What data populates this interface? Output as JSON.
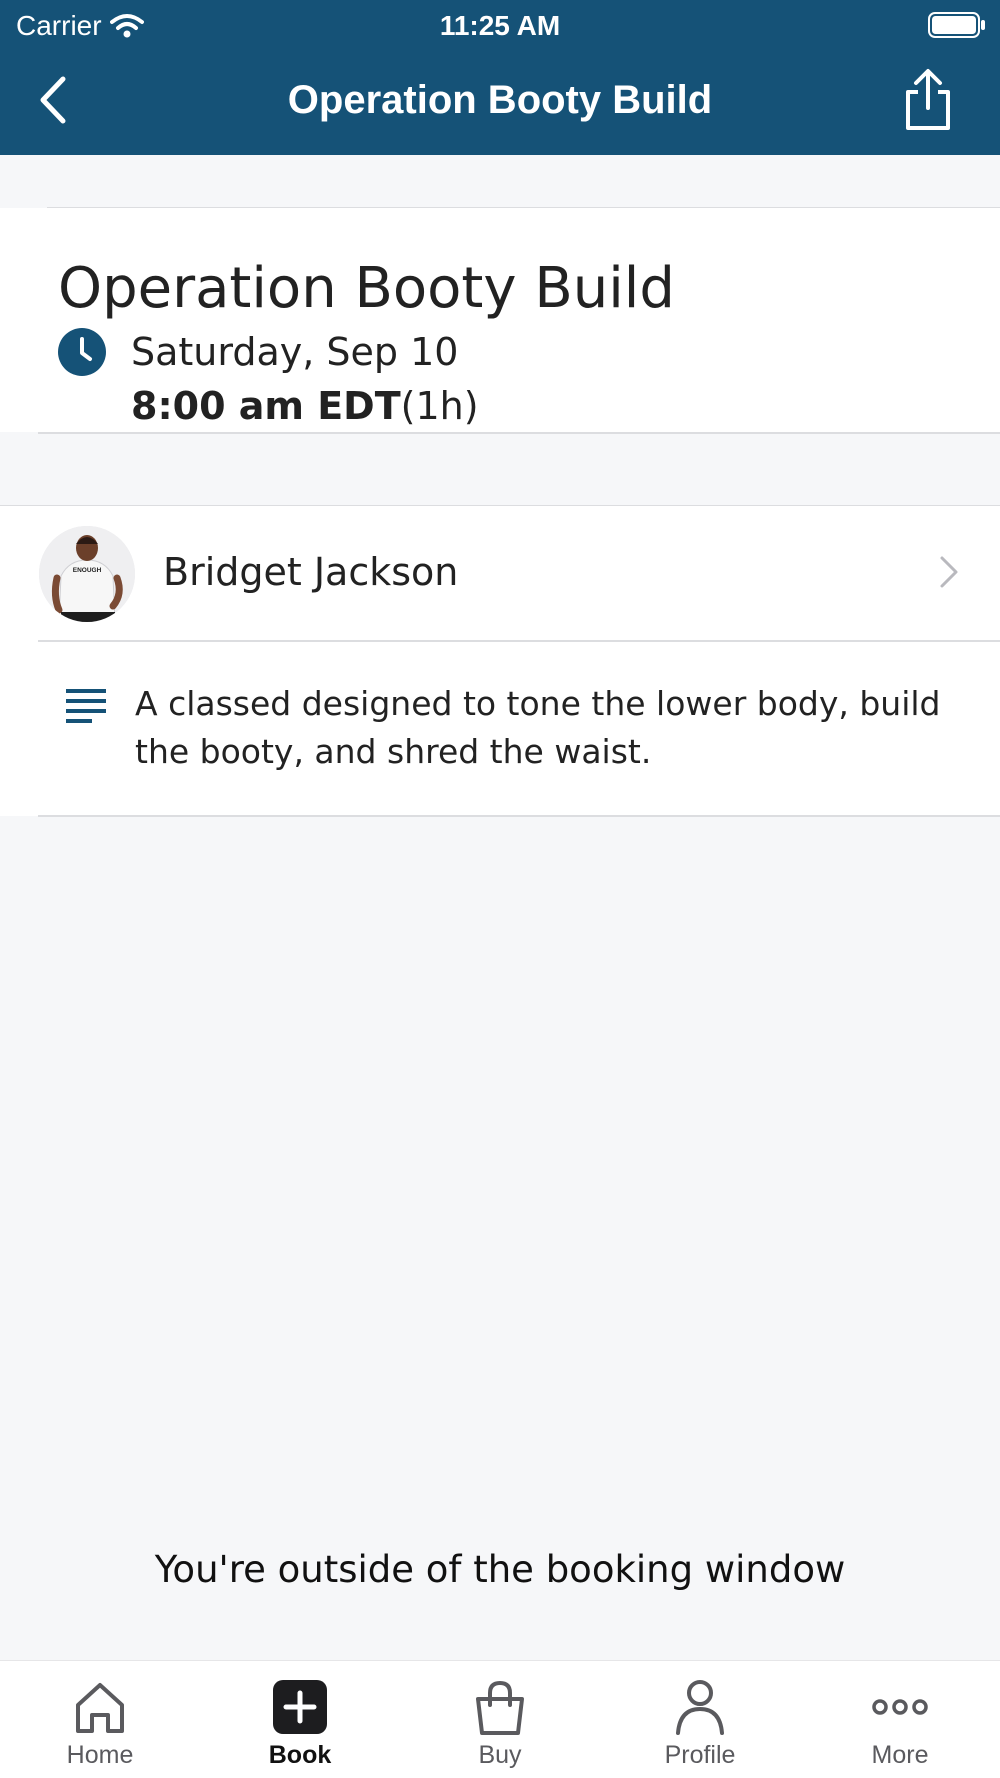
{
  "status_bar": {
    "carrier": "Carrier",
    "time": "11:25 AM"
  },
  "nav": {
    "title": "Operation Booty Build"
  },
  "class": {
    "title": "Operation Booty Build",
    "date": "Saturday, Sep 10",
    "time": "8:00 am EDT",
    "duration": "(1h)"
  },
  "instructor": {
    "name": "Bridget Jackson",
    "shirt_text": "ENOUGH"
  },
  "description": "A classed designed to tone the lower body, build the booty, and shred the waist.",
  "booking": {
    "message": "You're outside of the booking window"
  },
  "tabs": [
    {
      "label": "Home",
      "icon": "home-icon"
    },
    {
      "label": "Book",
      "icon": "plus-square-icon"
    },
    {
      "label": "Buy",
      "icon": "shopping-bag-icon"
    },
    {
      "label": "Profile",
      "icon": "person-icon"
    },
    {
      "label": "More",
      "icon": "more-dots-icon"
    }
  ],
  "active_tab": "Book",
  "colors": {
    "brand": "#155277",
    "background": "#f6f7f9",
    "divider": "#dcdde0"
  }
}
